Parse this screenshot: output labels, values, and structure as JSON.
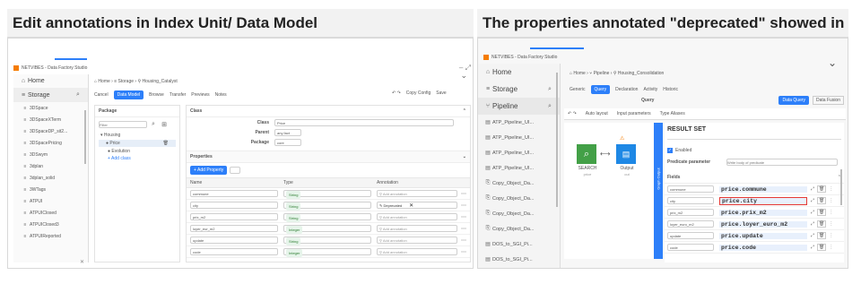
{
  "left": {
    "heading": "Edit annotations in Index Unit/ Data Model",
    "app_title": "NETVIBES - Data Factory Studio",
    "nav": {
      "home": "Home",
      "storage": "Storage"
    },
    "breadcrumb": [
      "Home",
      "Storage",
      "Housing_Catalyst"
    ],
    "toolbar": [
      "Cancel",
      "Data Model",
      "Browse",
      "Transfer",
      "Previews",
      "Notes"
    ],
    "copy_config": "Copy Config",
    "save": "Save",
    "storage_items": [
      "3DSpace",
      "3DSpaceXTerm",
      "3DSpaceDP_sit2...",
      "3DSpacePricing",
      "3DSwym",
      "3dplan",
      "3dplan_solid",
      "3WTags",
      "ATPUI",
      "ATPUIClosed",
      "ATPUIClosed3",
      "ATPUIReported"
    ],
    "package": {
      "label": "Package",
      "search_placeholder": "Filter",
      "tree_root": "Housing",
      "tree_items": [
        "Price",
        "Evolution",
        "Add class"
      ]
    },
    "class": {
      "label": "Class",
      "fields": [
        {
          "label": "Class",
          "value": "Price"
        },
        {
          "label": "Parent",
          "value": "any fact"
        },
        {
          "label": "Package",
          "value": "core"
        }
      ]
    },
    "properties": {
      "label": "Properties",
      "add_button": "Add Property",
      "cols": [
        "Name",
        "Type",
        "Annotation"
      ],
      "rows": [
        {
          "name": "commune",
          "type": "String",
          "ann": "Add annotation"
        },
        {
          "name": "city",
          "type": "String",
          "ann": "Deprecated"
        },
        {
          "name": "prix_m2",
          "type": "String",
          "ann": "Add annotation"
        },
        {
          "name": "loyer_eur_m2",
          "type": "Integer",
          "ann": "Add annotation"
        },
        {
          "name": "update",
          "type": "String",
          "ann": "Add annotation"
        },
        {
          "name": "code",
          "type": "Integer",
          "ann": "Add annotation"
        }
      ]
    }
  },
  "right": {
    "heading": "The properties annotated \"deprecated\" showed in red",
    "app_title": "NETVIBES - Data Factory Studio",
    "nav": {
      "home": "Home",
      "storage": "Storage",
      "pipeline": "Pipeline"
    },
    "breadcrumb": [
      "Home",
      "Pipeline",
      "Housing_Consolidation"
    ],
    "tabs": [
      "Generic",
      "Query",
      "Declaration",
      "Activity",
      "Historic"
    ],
    "query_label": "Query",
    "data_query": "Data Query",
    "data_fusion": "Data Fusion",
    "subtabs": [
      "Auto layout",
      "Input parameters",
      "Type Aliases"
    ],
    "pipeline_items": [
      "ATP_Pipeline_UI...",
      "ATP_Pipeline_UI...",
      "ATP_Pipeline_UI...",
      "ATP_Pipeline_UI...",
      "Copy_Object_Da...",
      "Copy_Object_Da...",
      "Copy_Object_Da...",
      "Copy_Object_Da...",
      "DOS_to_SGI_Pi...",
      "DOS_to_SGI_Pi..."
    ],
    "nodes": {
      "search": "SEARCH",
      "search_sub": "price",
      "output": "Output",
      "output_sub": "out"
    },
    "graph_output": "Graph Output",
    "result_set": "RESULT SET",
    "enabled": "Enabled",
    "predicate_label": "Predicate parameter",
    "predicate_placeholder": "Write body of predicate",
    "fields_label": "Fields",
    "fields": [
      {
        "name": "commune",
        "expr": "price.commune"
      },
      {
        "name": "city",
        "expr": "price.city"
      },
      {
        "name": "prix_m2",
        "expr": "price.prix_m2"
      },
      {
        "name": "loyer_euro_m2",
        "expr": "price.loyer_euro_m2"
      },
      {
        "name": "update",
        "expr": "price.update"
      },
      {
        "name": "code",
        "expr": "price.code"
      }
    ],
    "colors": {
      "deprecated": "#e53935",
      "accent": "#2d7ff9"
    }
  }
}
